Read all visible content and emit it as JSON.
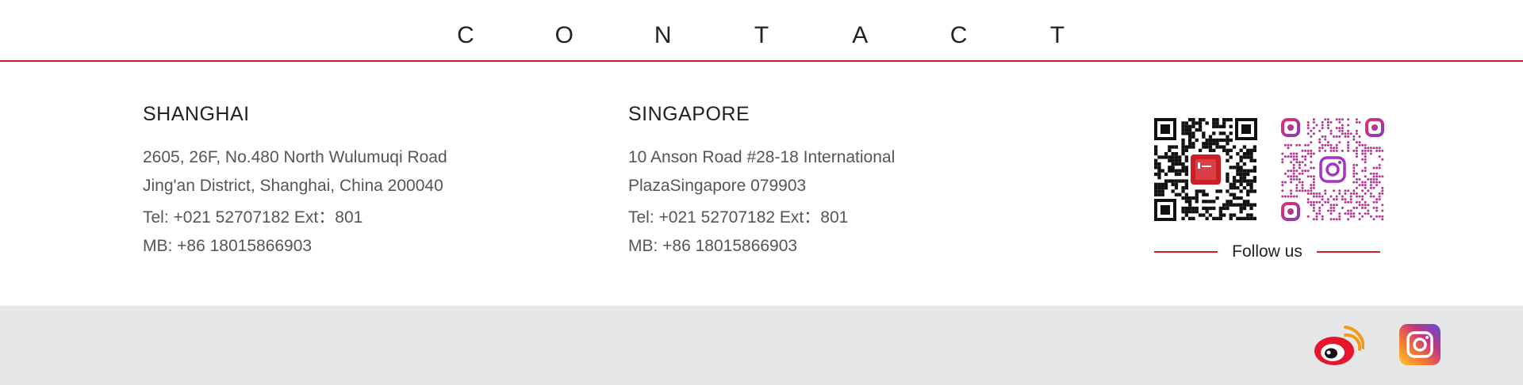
{
  "header": {
    "title_letters": [
      "C",
      "O",
      "N",
      "T",
      "A",
      "C",
      "T"
    ]
  },
  "offices": {
    "shanghai": {
      "city": "SHANGHAI",
      "address_line1": "2605, 26F, No.480 North Wulumuqi Road",
      "address_line2": "Jing'an District, Shanghai, China 200040",
      "tel": "Tel: +021 52707182 Ext：801",
      "mobile": "MB: +86 18015866903"
    },
    "singapore": {
      "city": "SINGAPORE",
      "address_line1": "10 Anson Road #28-18 International",
      "address_line2": "PlazaSingapore 079903",
      "tel": "Tel: +021 52707182 Ext：801",
      "mobile": "MB: +86 18015866903"
    }
  },
  "follow": {
    "label": "Follow us"
  },
  "qr_codes": [
    {
      "icon": "wechat-qr-code",
      "accent": "#cc1f25"
    },
    {
      "icon": "instagram-qr-code",
      "accent": "#b32bd0"
    }
  ],
  "social": [
    {
      "icon": "weibo-icon",
      "color": "#e6162d"
    },
    {
      "icon": "instagram-icon",
      "color": "#c13584"
    }
  ],
  "colors": {
    "accent": "#cc1f25",
    "footer_bg": "#e6e7e9"
  }
}
